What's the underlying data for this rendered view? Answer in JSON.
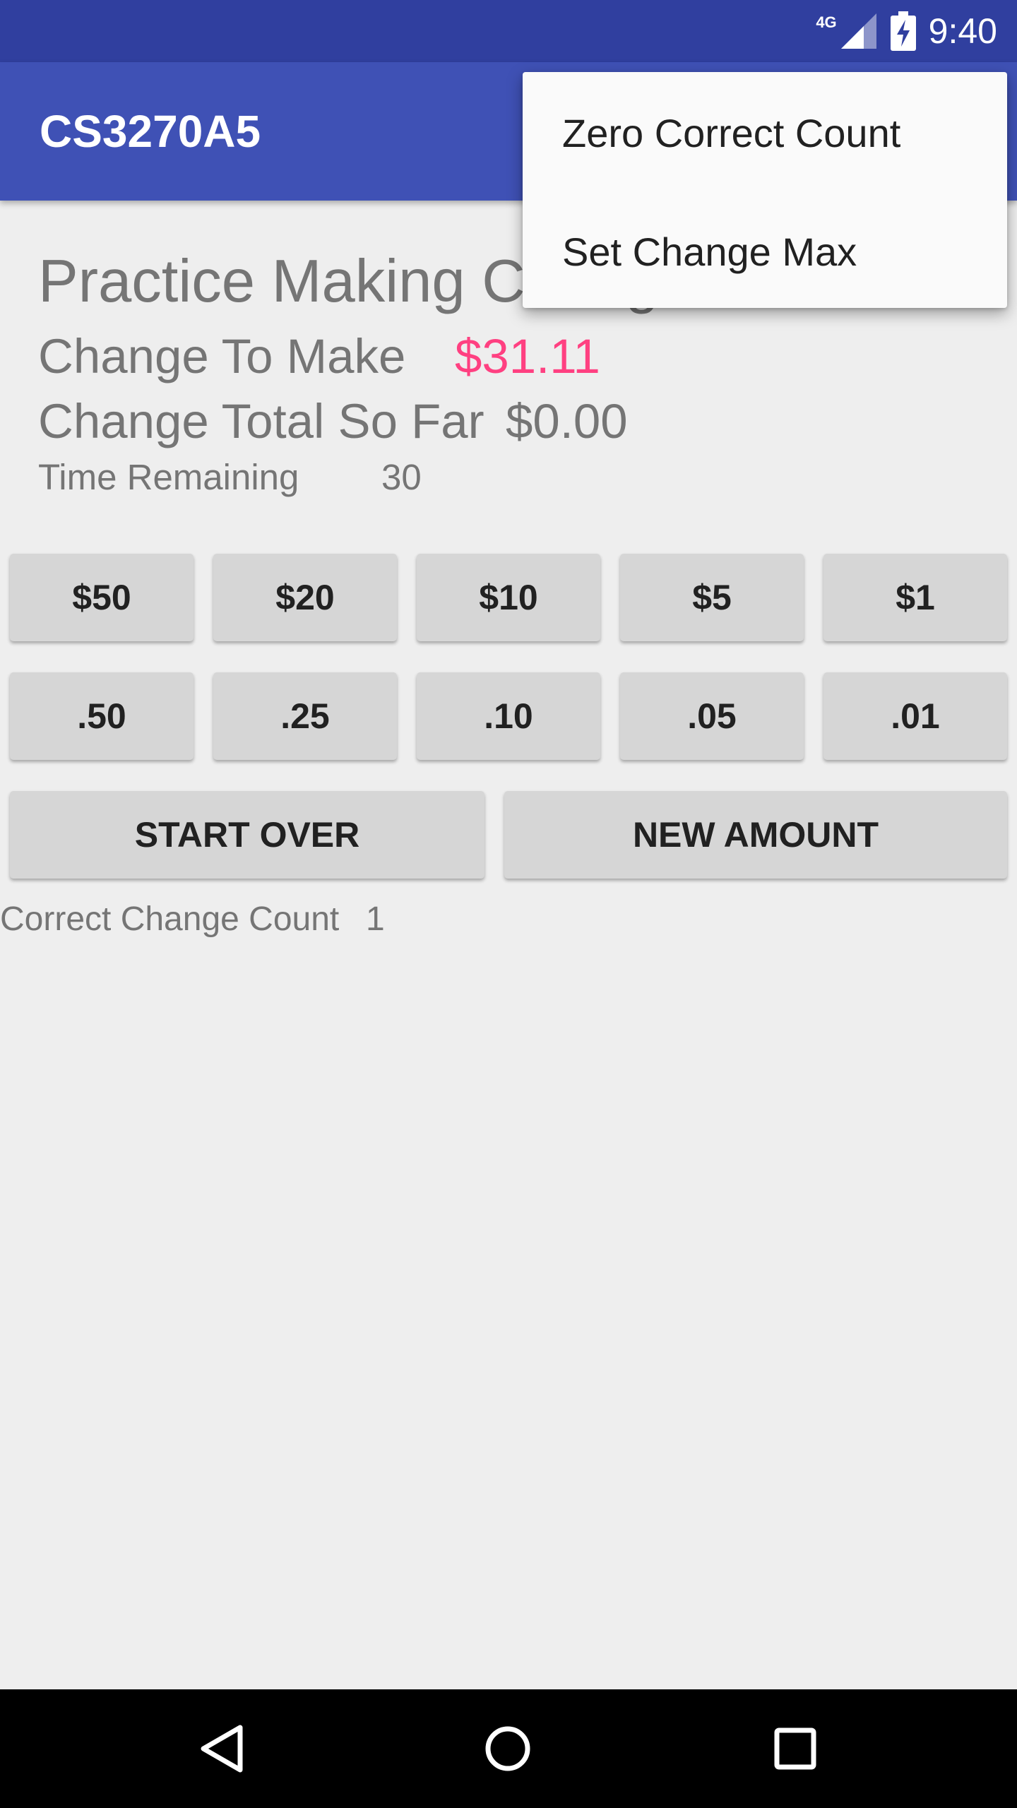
{
  "status_bar": {
    "network": "4G",
    "time": "9:40",
    "icons": [
      "signal-icon",
      "battery-charging-icon"
    ]
  },
  "app_bar": {
    "title": "CS3270A5"
  },
  "main": {
    "heading": "Practice Making Change",
    "change_to_make_label": "Change To Make",
    "change_to_make_value": "$31.11",
    "change_total_label": "Change Total So Far",
    "change_total_value": "$0.00",
    "time_remaining_label": "Time Remaining",
    "time_remaining_value": "30",
    "bills": [
      "$50",
      "$20",
      "$10",
      "$5",
      "$1"
    ],
    "coins": [
      ".50",
      ".25",
      ".10",
      ".05",
      ".01"
    ],
    "start_over_label": "START OVER",
    "new_amount_label": "NEW AMOUNT",
    "correct_count_label": "Correct Change Count",
    "correct_count_value": "1"
  },
  "overflow_menu": {
    "items": [
      "Zero Correct Count",
      "Set Change Max"
    ]
  },
  "nav_bar": {
    "icons": [
      "back-icon",
      "home-icon",
      "recents-icon"
    ]
  },
  "colors": {
    "status_bar": "#303f9f",
    "app_bar": "#3f51b5",
    "accent": "#ff4081",
    "background": "#eeeeee",
    "button": "#d6d6d6"
  }
}
